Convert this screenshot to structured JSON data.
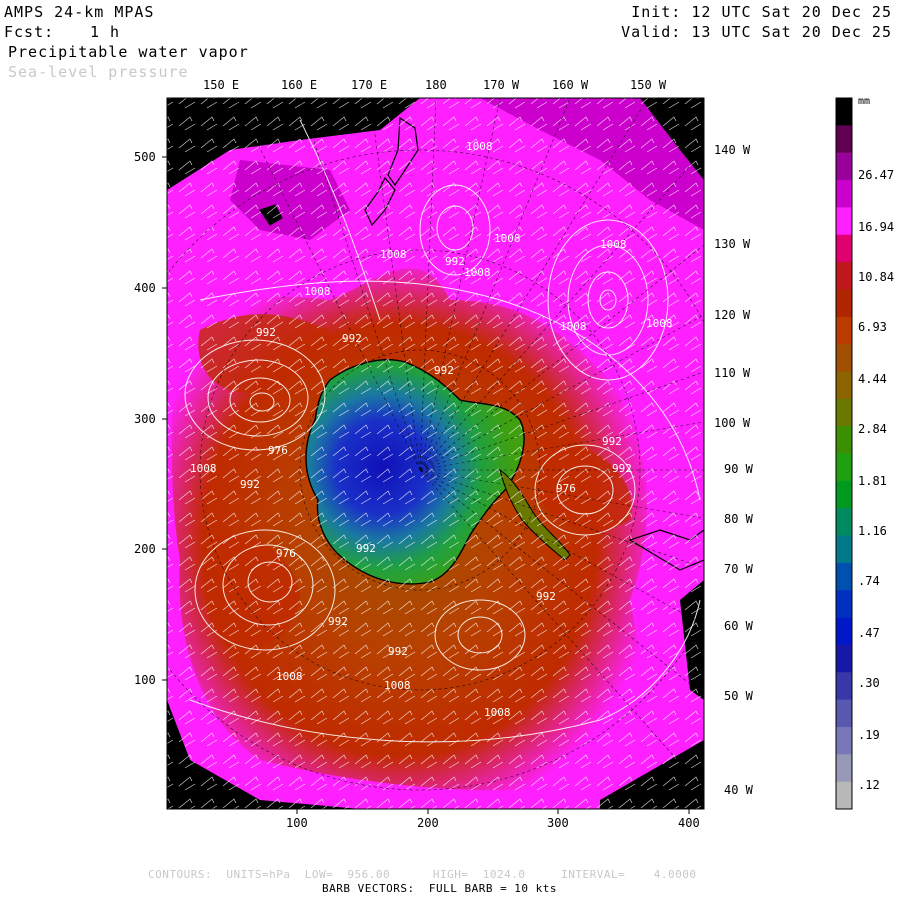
{
  "header": {
    "model": "AMPS 24-km MPAS",
    "forecast_label": "Fcst:",
    "forecast_value": "1 h",
    "field_primary": "Precipitable water vapor",
    "field_secondary": "Sea-level pressure",
    "init": "Init: 12 UTC Sat 20 Dec 25",
    "valid": "Valid: 13 UTC Sat 20 Dec 25"
  },
  "top_lon_labels": [
    "150 E",
    "160 E",
    "170 E",
    "180",
    "170 W",
    "160 W",
    "150 W"
  ],
  "right_lon_labels": [
    "140 W",
    "130 W",
    "120 W",
    "110 W",
    "100 W",
    "90 W",
    "80 W",
    "70 W",
    "60 W",
    "50 W",
    "40 W"
  ],
  "y_axis_ticks": [
    "500",
    "400",
    "300",
    "200",
    "100"
  ],
  "x_axis_ticks": [
    "100",
    "200",
    "300",
    "400"
  ],
  "pressure_labels": [
    "1008",
    "1008",
    "1008",
    "1008",
    "1008",
    "1008",
    "1008",
    "1008",
    "1008",
    "1008",
    "1008",
    "1008",
    "992",
    "992",
    "992",
    "992",
    "992",
    "992",
    "992",
    "992",
    "992",
    "992",
    "992",
    "976",
    "976",
    "976"
  ],
  "colorbar": {
    "unit": "mm",
    "labels": [
      "26.47",
      "16.94",
      "10.84",
      "6.93",
      "4.44",
      "2.84",
      "1.81",
      "1.16",
      ".74",
      ".47",
      ".30",
      ".19",
      ".12"
    ],
    "colors": [
      "#000000",
      "#600050",
      "#9a009a",
      "#cc00cc",
      "#ff20ff",
      "#e00070",
      "#c0181c",
      "#b02400",
      "#bb3c00",
      "#a05000",
      "#8c6400",
      "#6a7800",
      "#3a9000",
      "#20a010",
      "#009a20",
      "#008a60",
      "#007a88",
      "#0050b0",
      "#0030c0",
      "#0018c8",
      "#1818a8",
      "#3838a8",
      "#5858b0",
      "#7878b8",
      "#9898b8",
      "#b8b8b8"
    ]
  },
  "footer": {
    "contours": "CONTOURS:  UNITS=hPa  LOW=  956.00      HIGH=  1024.0     INTERVAL=    4.0000",
    "barbs": "BARB VECTORS:  FULL BARB = 10 kts"
  }
}
